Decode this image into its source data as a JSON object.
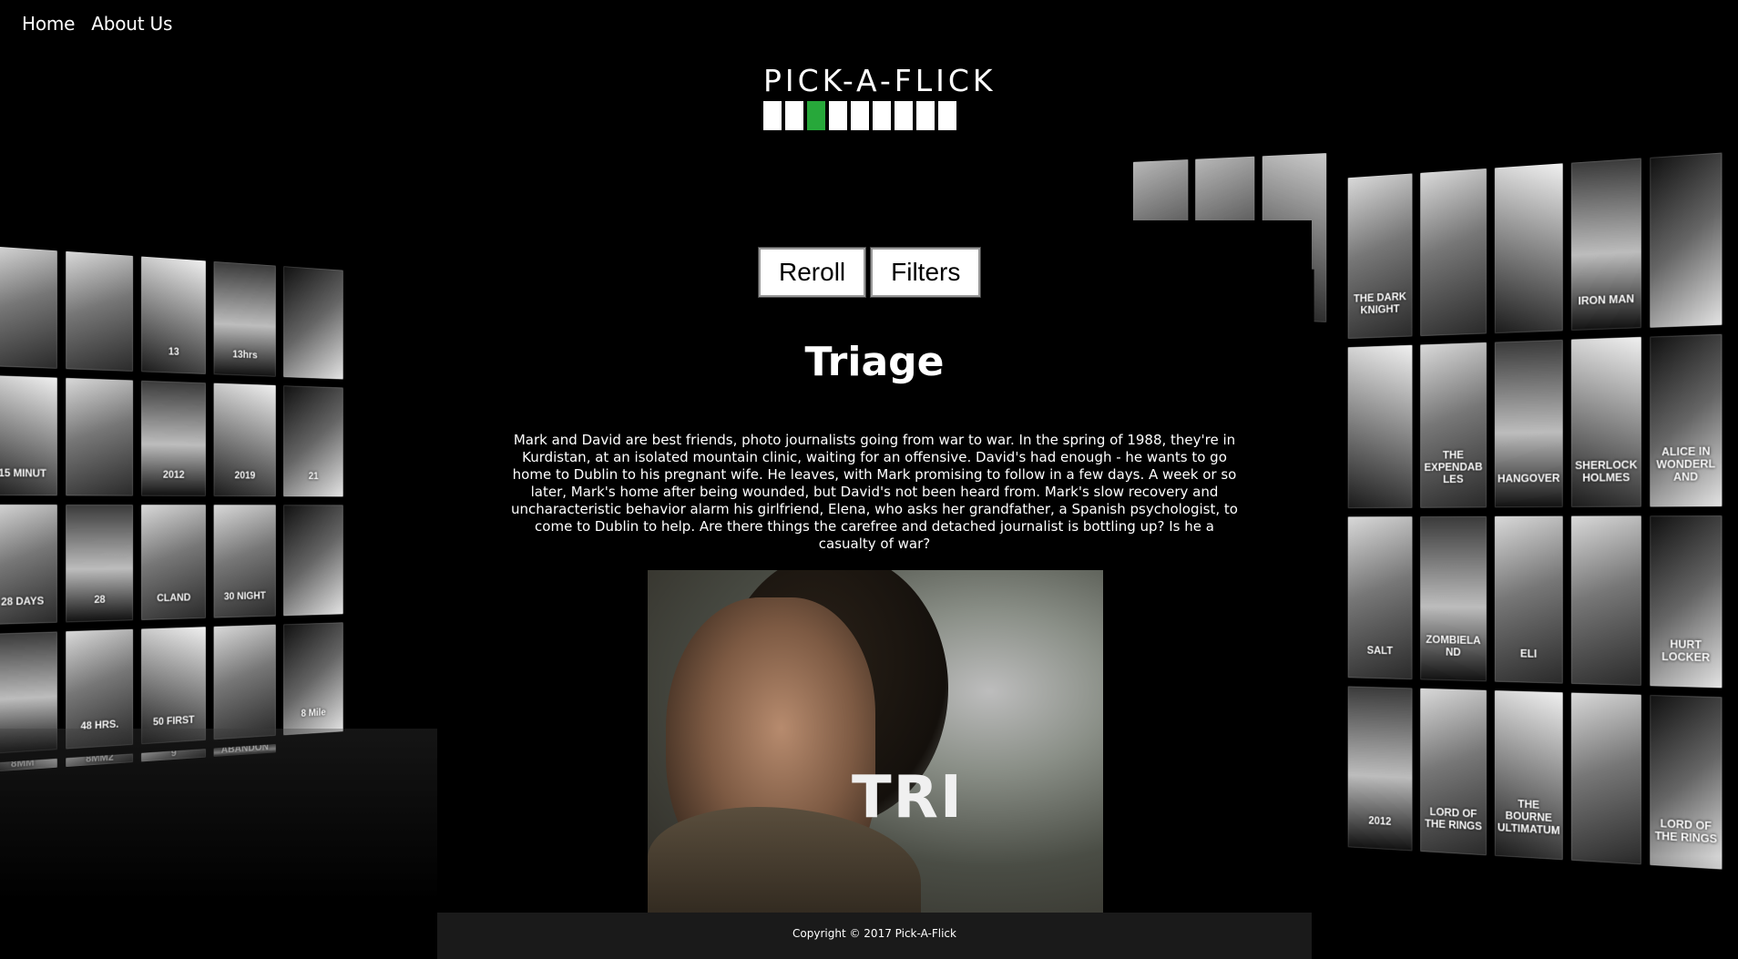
{
  "nav": {
    "home": "Home",
    "about": "About Us"
  },
  "logo": {
    "text": "PICK-A-FLICK",
    "accent_color": "#27a83a"
  },
  "buttons": {
    "reroll": "Reroll",
    "filters": "Filters"
  },
  "movie": {
    "title": "Triage",
    "description": "Mark and David are best friends, photo journalists going from war to war. In the spring of 1988, they're in Kurdistan, at an isolated mountain clinic, waiting for an offensive. David's had enough - he wants to go home to Dublin to his pregnant wife. He leaves, with Mark promising to follow in a few days. A week or so later, Mark's home after being wounded, but David's not been heard from. Mark's slow recovery and uncharacteristic behavior alarm his girlfriend, Elena, who asks her grandfather, a Spanish psychologist, to come to Dublin to help. Are there things the carefree and detached journalist is bottling up? Is he a casualty of war?",
    "poster_text": "TRI"
  },
  "footer": {
    "copyright": "Copyright © 2017 Pick-A-Flick"
  },
  "walls": {
    "left": [
      "",
      "",
      "13",
      "13hrs",
      "",
      "15 MINUT",
      "",
      "2012",
      "2019",
      "21",
      "28 DAYS",
      "28",
      "CLAND",
      "30 NIGHT",
      "",
      "",
      "48 HRS.",
      "50 FIRST",
      "",
      "8 Mile",
      "8MM",
      "8MM2",
      "9",
      "ABANDON"
    ],
    "right_back": [
      "",
      "",
      ""
    ],
    "right": [
      "THE DARK KNIGHT",
      "",
      "",
      "IRON MAN",
      "",
      "",
      "THE EXPENDABLES",
      "HANGOVER",
      "SHERLOCK HOLMES",
      "ALICE IN WONDERLAND",
      "SALT",
      "ZOMBIELAND",
      "ELI",
      "",
      "HURT LOCKER",
      "2012",
      "LORD OF THE RINGS",
      "THE BOURNE ULTIMATUM",
      "",
      "LORD OF THE RINGS"
    ]
  }
}
